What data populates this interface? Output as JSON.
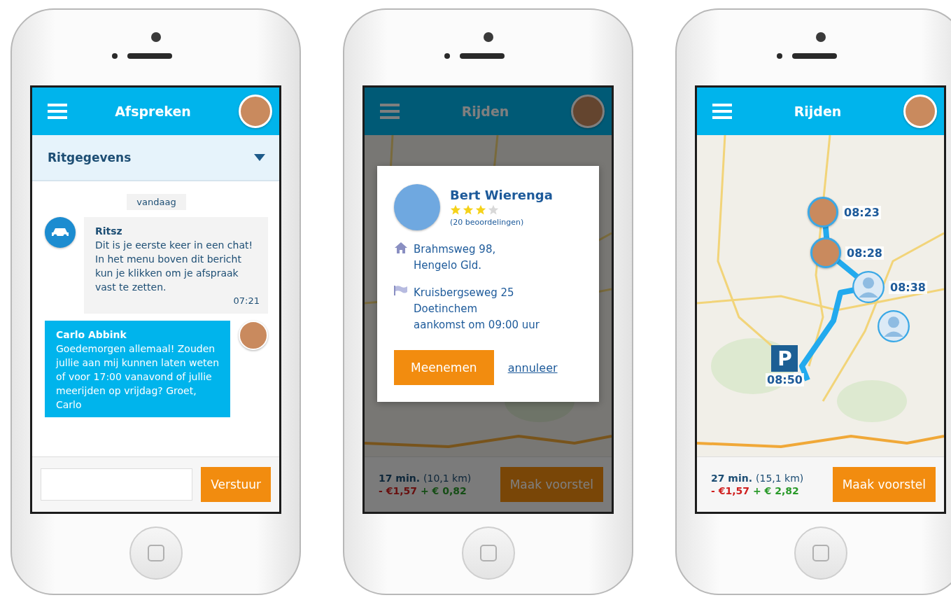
{
  "phones": [
    {
      "kind": "chat",
      "header": {
        "title": "Afspreken"
      },
      "section": {
        "title": "Ritgegevens",
        "expanded": false
      },
      "date_chip": "vandaag",
      "messages": [
        {
          "kind": "incoming",
          "sender": "Ritsz",
          "text": "Dit is je eerste keer in een chat! In het menu boven dit bericht kun je klikken om je afspraak vast te zetten.",
          "time": "07:21"
        },
        {
          "kind": "outgoing",
          "sender": "Carlo Abbink",
          "text": "Goedemorgen allemaal! Zouden jullie aan mij kunnen laten weten of voor 17:00 vanavond of jullie meerijden op vrijdag? Groet, Carlo"
        }
      ],
      "composer": {
        "button": "Verstuur"
      }
    },
    {
      "kind": "map",
      "header": {
        "title": "Rijden"
      },
      "modal": {
        "name": "Bert Wierenga",
        "stars": 3,
        "reviews": "(20 beoordelingen)",
        "from": "Brahmsweg 98,\nHengelo Gld.",
        "to": "Kruisbergseweg 25\nDoetinchem\naankomst om 09:00 uur",
        "confirm": "Meenemen",
        "cancel": "annuleer"
      },
      "footer": {
        "duration": "17 min.",
        "distance": "(10,1 km)",
        "cost": "- €1,57",
        "gain": "+ € 0,82",
        "button": "Maak voorstel"
      }
    },
    {
      "kind": "map",
      "header": {
        "title": "Rijden"
      },
      "markers": [
        {
          "kind": "photo",
          "time": "08:23"
        },
        {
          "kind": "photo",
          "time": "08:28"
        },
        {
          "kind": "placeholder",
          "time": "08:38"
        },
        {
          "kind": "placeholder"
        }
      ],
      "parking": {
        "sign": "P",
        "time": "08:50"
      },
      "footer": {
        "duration": "27 min.",
        "distance": "(15,1 km)",
        "cost": "- €1,57",
        "gain": "+ € 2,82",
        "button": "Maak voorstel"
      }
    }
  ]
}
